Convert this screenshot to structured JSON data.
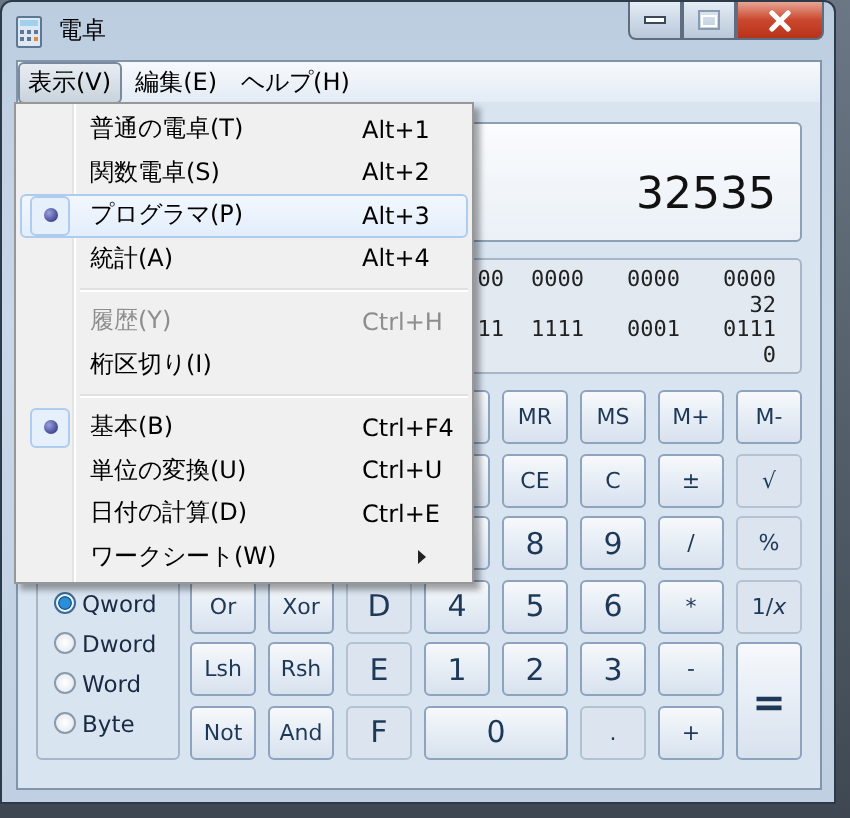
{
  "window": {
    "title": "電卓"
  },
  "menu_bar": [
    {
      "label": "表示(V)",
      "selected": true
    },
    {
      "label": "編集(E)",
      "selected": false
    },
    {
      "label": "ヘルプ(H)",
      "selected": false
    }
  ],
  "view_menu": [
    {
      "kind": "item",
      "label": "普通の電卓(T)",
      "shortcut": "Alt+1",
      "checked": false,
      "selected": false,
      "disabled": false
    },
    {
      "kind": "item",
      "label": "関数電卓(S)",
      "shortcut": "Alt+2",
      "checked": false,
      "selected": false,
      "disabled": false
    },
    {
      "kind": "item",
      "label": "プログラマ(P)",
      "shortcut": "Alt+3",
      "checked": true,
      "selected": true,
      "disabled": false
    },
    {
      "kind": "item",
      "label": "統計(A)",
      "shortcut": "Alt+4",
      "checked": false,
      "selected": false,
      "disabled": false
    },
    {
      "kind": "separator"
    },
    {
      "kind": "item",
      "label": "履歴(Y)",
      "shortcut": "Ctrl+H",
      "checked": false,
      "selected": false,
      "disabled": true
    },
    {
      "kind": "item",
      "label": "桁区切り(I)",
      "checked": false,
      "selected": false,
      "disabled": false
    },
    {
      "kind": "separator"
    },
    {
      "kind": "item",
      "label": "基本(B)",
      "shortcut": "Ctrl+F4",
      "checked": true,
      "selected": false,
      "disabled": false
    },
    {
      "kind": "item",
      "label": "単位の変換(U)",
      "shortcut": "Ctrl+U",
      "checked": false,
      "selected": false,
      "disabled": false
    },
    {
      "kind": "item",
      "label": "日付の計算(D)",
      "shortcut": "Ctrl+E",
      "checked": false,
      "selected": false,
      "disabled": false
    },
    {
      "kind": "item",
      "label": "ワークシート(W)",
      "checked": false,
      "selected": false,
      "disabled": false,
      "submenu": true
    }
  ],
  "display": {
    "value": "32535"
  },
  "binary_display": [
    {
      "groups": [
        "00",
        "0000",
        "0000",
        "0000"
      ],
      "bit_index": "32"
    },
    {
      "groups": [
        "11",
        "1111",
        "0001",
        "0111"
      ],
      "bit_index": "0"
    }
  ],
  "word_size": [
    {
      "label": "Qword",
      "selected": true
    },
    {
      "label": "Dword",
      "selected": false
    },
    {
      "label": "Word",
      "selected": false
    },
    {
      "label": "Byte",
      "selected": false
    }
  ],
  "keys": [
    {
      "kind": "hidden"
    },
    {
      "kind": "hidden"
    },
    {
      "kind": "hidden"
    },
    {
      "kind": "blank"
    },
    {
      "kind": "key",
      "label": "MR",
      "disabled": false
    },
    {
      "kind": "key",
      "label": "MS",
      "disabled": false
    },
    {
      "kind": "key",
      "label": "M+",
      "disabled": false
    },
    {
      "kind": "key",
      "label": "M-",
      "disabled": false
    },
    {
      "kind": "hidden"
    },
    {
      "kind": "hidden"
    },
    {
      "kind": "hidden"
    },
    {
      "kind": "blank"
    },
    {
      "kind": "key",
      "label": "CE",
      "disabled": false
    },
    {
      "kind": "key",
      "label": "C",
      "disabled": false
    },
    {
      "kind": "key",
      "label": "±",
      "disabled": false
    },
    {
      "kind": "key",
      "label": "√",
      "disabled": true
    },
    {
      "kind": "hidden"
    },
    {
      "kind": "hidden"
    },
    {
      "kind": "hidden"
    },
    {
      "kind": "blank"
    },
    {
      "kind": "digit",
      "label": "8",
      "disabled": false
    },
    {
      "kind": "digit",
      "label": "9",
      "disabled": false
    },
    {
      "kind": "key",
      "label": "/",
      "disabled": false
    },
    {
      "kind": "key",
      "label": "%",
      "disabled": true
    },
    {
      "kind": "key",
      "label": "Or",
      "disabled": false
    },
    {
      "kind": "key",
      "label": "Xor",
      "disabled": false
    },
    {
      "kind": "digit",
      "label": "D",
      "disabled": true
    },
    {
      "kind": "digit",
      "label": "4",
      "disabled": false
    },
    {
      "kind": "digit",
      "label": "5",
      "disabled": false
    },
    {
      "kind": "digit",
      "label": "6",
      "disabled": false
    },
    {
      "kind": "key",
      "label": "*",
      "disabled": false
    },
    {
      "kind": "key",
      "label": "1/*x*",
      "disabled": true
    },
    {
      "kind": "key",
      "label": "Lsh",
      "disabled": false
    },
    {
      "kind": "key",
      "label": "Rsh",
      "disabled": false
    },
    {
      "kind": "digit",
      "label": "E",
      "disabled": true
    },
    {
      "kind": "digit",
      "label": "1",
      "disabled": false
    },
    {
      "kind": "digit",
      "label": "2",
      "disabled": false
    },
    {
      "kind": "digit",
      "label": "3",
      "disabled": false
    },
    {
      "kind": "key",
      "label": "-",
      "disabled": false
    },
    {
      "kind": "tall",
      "label": "=",
      "disabled": false
    },
    {
      "kind": "key",
      "label": "Not",
      "disabled": false
    },
    {
      "kind": "key",
      "label": "And",
      "disabled": false
    },
    {
      "kind": "digit",
      "label": "F",
      "disabled": true
    },
    {
      "kind": "wide",
      "label": "0",
      "disabled": false
    },
    {
      "kind": "key",
      "label": ".",
      "disabled": true
    },
    {
      "kind": "key",
      "label": "+",
      "disabled": false
    }
  ]
}
